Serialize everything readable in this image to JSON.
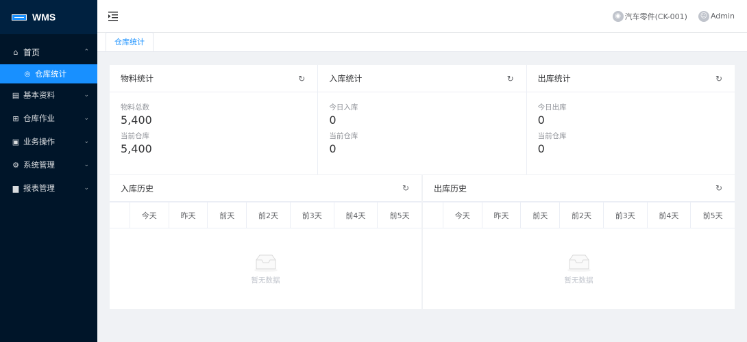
{
  "app": {
    "logo_text": "WMS"
  },
  "sidebar": {
    "home": {
      "label": "首页",
      "icon": "home-icon",
      "arrow": "⌃"
    },
    "home_sub": {
      "label": "仓库统计",
      "icon": "dashboard-icon"
    },
    "items": [
      {
        "label": "基本资料",
        "icon": "profile-icon"
      },
      {
        "label": "仓库作业",
        "icon": "grid-icon"
      },
      {
        "label": "业务操作",
        "icon": "form-icon"
      },
      {
        "label": "系统管理",
        "icon": "gear-icon"
      },
      {
        "label": "报表管理",
        "icon": "chart-icon"
      }
    ]
  },
  "header": {
    "warehouse": "汽车零件(CK-001)",
    "user": "Admin"
  },
  "tabs": [
    {
      "label": "仓库统计"
    }
  ],
  "stats": [
    {
      "title": "物料统计",
      "labels": [
        "物料总数",
        "当前仓库"
      ],
      "values": [
        "5,400",
        "5,400"
      ]
    },
    {
      "title": "入库统计",
      "labels": [
        "今日入库",
        "当前仓库"
      ],
      "values": [
        "0",
        "0"
      ]
    },
    {
      "title": "出库统计",
      "labels": [
        "今日出库",
        "当前仓库"
      ],
      "values": [
        "0",
        "0"
      ]
    }
  ],
  "history": [
    {
      "title": "入库历史",
      "columns": [
        "今天",
        "昨天",
        "前天",
        "前2天",
        "前3天",
        "前4天",
        "前5天"
      ],
      "empty_text": "暂无数据"
    },
    {
      "title": "出库历史",
      "columns": [
        "今天",
        "昨天",
        "前天",
        "前2天",
        "前3天",
        "前4天",
        "前5天"
      ],
      "empty_text": "暂无数据"
    }
  ],
  "colors": {
    "sidebar_bg": "#001529",
    "accent": "#1890ff",
    "page_bg": "#f0f2f5"
  }
}
